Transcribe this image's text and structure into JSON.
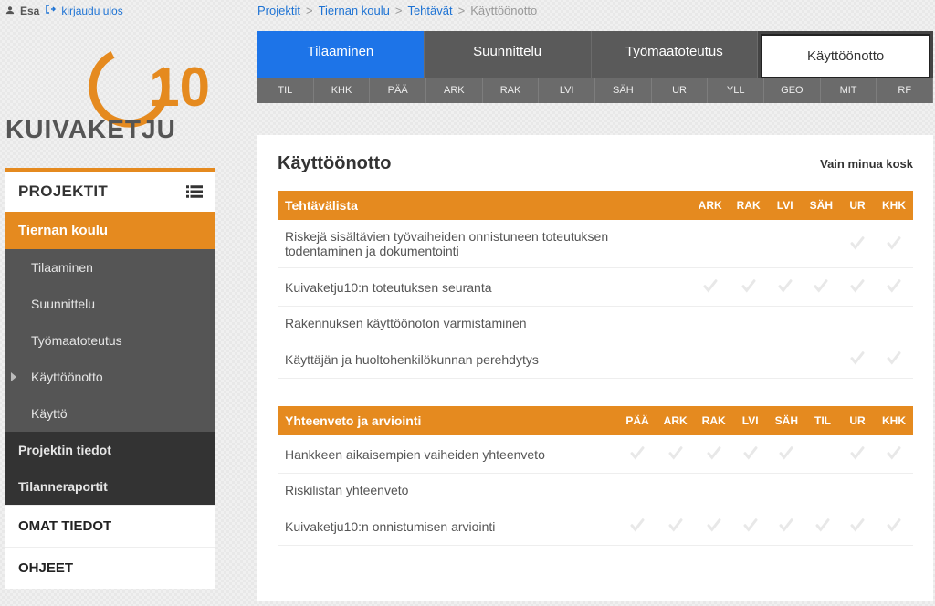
{
  "user": {
    "name": "Esa",
    "logout": "kirjaudu ulos"
  },
  "logo": {
    "brand": "KUIVAKETJU",
    "number": "10"
  },
  "breadcrumb": {
    "a": "Projektit",
    "b": "Tiernan koulu",
    "c": "Tehtävät",
    "d": "Käyttöönotto",
    "sep": ">"
  },
  "tabs": {
    "t0": "Tilaaminen",
    "t1": "Suunnittelu",
    "t2": "Työmaatoteutus",
    "t3": "Käyttöönotto"
  },
  "roles": {
    "r0": "TIL",
    "r1": "KHK",
    "r2": "PÄÄ",
    "r3": "ARK",
    "r4": "RAK",
    "r5": "LVI",
    "r6": "SÄH",
    "r7": "UR",
    "r8": "YLL",
    "r9": "GEO",
    "r10": "MIT",
    "r11": "RF"
  },
  "sidebar": {
    "h1": "PROJEKTIT",
    "active": "Tiernan koulu",
    "s0": "Tilaaminen",
    "s1": "Suunnittelu",
    "s2": "Työmaatoteutus",
    "s3": "Käyttöönotto",
    "s4": "Käyttö",
    "i0": "Projektin tiedot",
    "i1": "Tilanneraportit",
    "h2": "OMAT TIEDOT",
    "h3": "OHJEET"
  },
  "panel": {
    "title": "Käyttöönotto",
    "filter": "Vain minua kosk"
  },
  "table1": {
    "h": "Tehtävälista",
    "c": {
      "c0": "ARK",
      "c1": "RAK",
      "c2": "LVI",
      "c3": "SÄH",
      "c4": "UR",
      "c5": "KHK"
    },
    "r0": "Riskejä sisältävien työvaiheiden onnistuneen toteutuksen todentaminen ja dokumentointi",
    "r1": "Kuivaketju10:n toteutuksen seuranta",
    "r2": "Rakennuksen käyttöönoton varmistaminen",
    "r3": "Käyttäjän ja huoltohenkilökunnan perehdytys"
  },
  "table2": {
    "h": "Yhteenveto ja arviointi",
    "c": {
      "c0": "PÄÄ",
      "c1": "ARK",
      "c2": "RAK",
      "c3": "LVI",
      "c4": "SÄH",
      "c5": "TIL",
      "c6": "UR",
      "c7": "KHK"
    },
    "r0": "Hankkeen aikaisempien vaiheiden yhteenveto",
    "r1": "Riskilistan yhteenveto",
    "r2": "Kuivaketju10:n onnistumisen arviointi"
  }
}
